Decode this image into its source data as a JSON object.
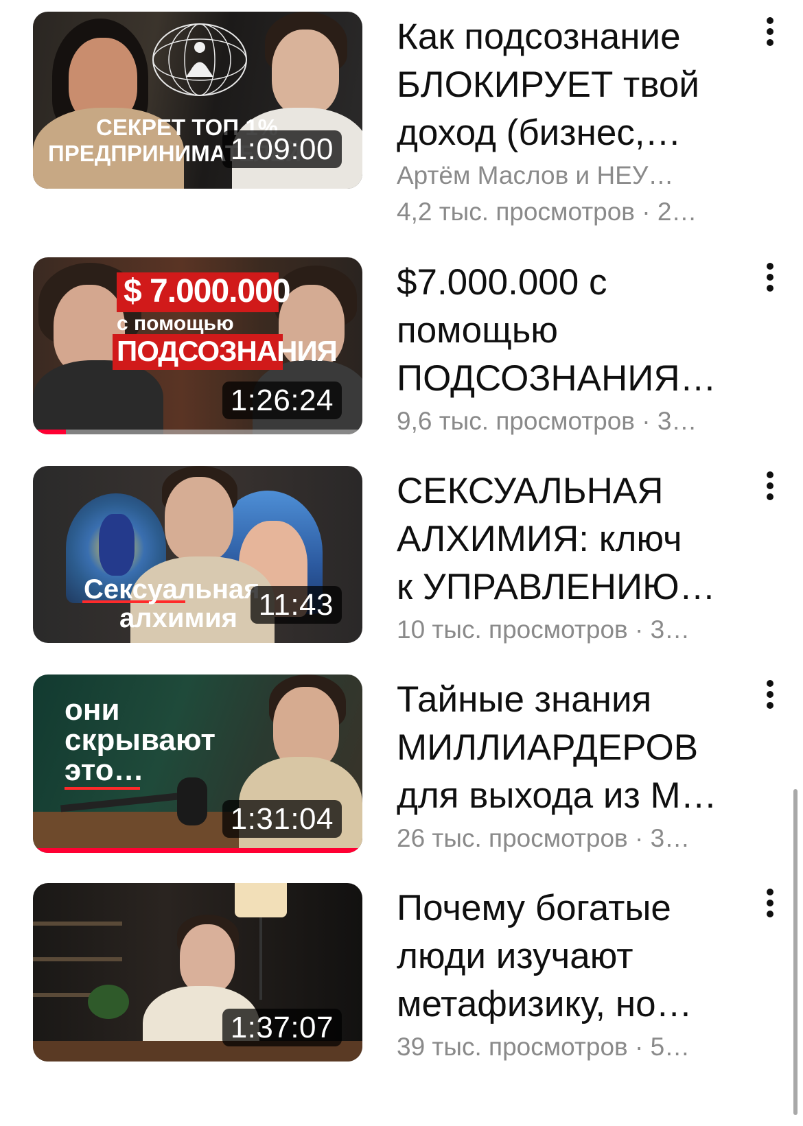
{
  "colors": {
    "title_text": "#0f0f0f",
    "meta_text": "#8a8a8a",
    "progress_red": "#ff0033",
    "duration_bg": "#000000",
    "background": "#ffffff"
  },
  "videos": [
    {
      "title_lines": [
        "Как подсознание",
        "БЛОКИРУЕТ твой",
        "доход (бизнес,…"
      ],
      "channel": "Артём Маслов и НЕУ…",
      "stats": "4,2 тыс. просмотров · 2…",
      "duration": "1:09:00",
      "watched_fraction": 0,
      "thumb_text": [
        "СЕКРЕТ ТОП 1%",
        "ПРЕДПРИНИМАТЕЛЕЙ"
      ],
      "menu_icon": "more-vertical-icon"
    },
    {
      "title_lines": [
        "$7.000.000 с",
        "помощью",
        "ПОДСОЗНАНИЯ…"
      ],
      "channel": "",
      "stats": "9,6 тыс. просмотров · 3…",
      "duration": "1:26:24",
      "watched_fraction": 0.1,
      "thumb_text": [
        "$ 7.000.000",
        "с помощью",
        "ПОДСОЗНАНИЯ"
      ],
      "menu_icon": "more-vertical-icon"
    },
    {
      "title_lines": [
        "СЕКСУАЛЬНАЯ",
        "АЛХИМИЯ: ключ",
        "к УПРАВЛЕНИЮ…"
      ],
      "channel": "",
      "stats": "10 тыс. просмотров · 3…",
      "duration": "11:43",
      "watched_fraction": 0,
      "thumb_text": [
        "Сексуальная",
        "алхимия"
      ],
      "menu_icon": "more-vertical-icon"
    },
    {
      "title_lines": [
        "Тайные знания",
        "МИЛЛИАРДЕРОВ",
        "для выхода из М…"
      ],
      "channel": "",
      "stats": "26 тыс. просмотров · 3…",
      "duration": "1:31:04",
      "watched_fraction": 1.0,
      "thumb_text": [
        "они",
        "скрывают",
        "это…"
      ],
      "menu_icon": "more-vertical-icon"
    },
    {
      "title_lines": [
        "Почему богатые",
        "люди изучают",
        "метафизику, но…"
      ],
      "channel": "",
      "stats": "39 тыс. просмотров · 5…",
      "duration": "1:37:07",
      "watched_fraction": 0,
      "thumb_text": [],
      "menu_icon": "more-vertical-icon"
    }
  ]
}
